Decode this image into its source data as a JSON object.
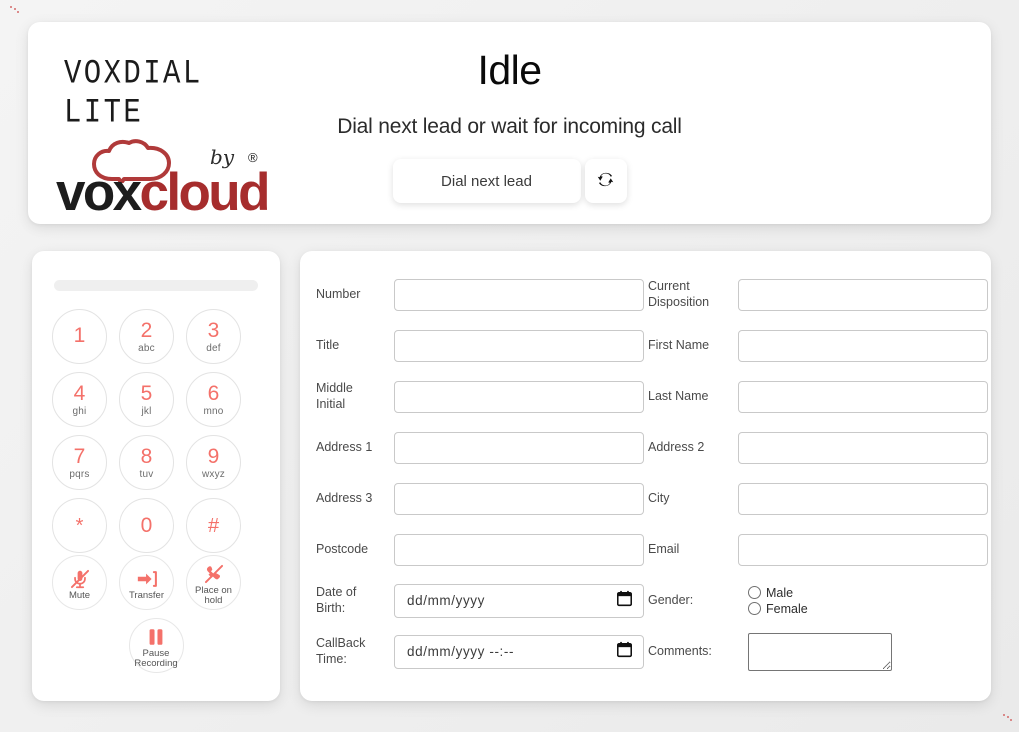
{
  "brand": {
    "product_name": "VOXDIAL LITE",
    "by_text": "by",
    "company_part1": "vox",
    "company_part2": "cloud",
    "registered_mark": "®",
    "brand_red": "#a62d2d",
    "accent_red": "#f4716a"
  },
  "header": {
    "status_title": "Idle",
    "status_subtitle": "Dial next lead or wait for incoming call",
    "dial_button_label": "Dial next lead",
    "refresh_icon": "refresh-icon"
  },
  "dialpad": {
    "keys": [
      {
        "digit": "1",
        "letters": ""
      },
      {
        "digit": "2",
        "letters": "abc"
      },
      {
        "digit": "3",
        "letters": "def"
      },
      {
        "digit": "4",
        "letters": "ghi"
      },
      {
        "digit": "5",
        "letters": "jkl"
      },
      {
        "digit": "6",
        "letters": "mno"
      },
      {
        "digit": "7",
        "letters": "pqrs"
      },
      {
        "digit": "8",
        "letters": "tuv"
      },
      {
        "digit": "9",
        "letters": "wxyz"
      },
      {
        "digit": "*",
        "letters": ""
      },
      {
        "digit": "0",
        "letters": ""
      },
      {
        "digit": "#",
        "letters": ""
      }
    ],
    "actions": [
      {
        "label": "Mute",
        "icon": "microphone-muted-icon"
      },
      {
        "label": "Transfer",
        "icon": "transfer-arrow-icon"
      },
      {
        "label_line1": "Place on",
        "label_line2": "hold",
        "icon": "phone-hold-icon"
      },
      {
        "label_line1": "Pause",
        "label_line2": "Recording",
        "icon": "pause-icon"
      }
    ]
  },
  "form": {
    "rows": [
      {
        "left_label": "Number",
        "left_value": "",
        "right_label_line1": "Current",
        "right_label_line2": "Disposition",
        "right_value": ""
      },
      {
        "left_label": "Title",
        "left_value": "",
        "right_label_line1": "First Name",
        "right_label_line2": "",
        "right_value": ""
      },
      {
        "left_label_line1": "Middle",
        "left_label_line2": "Initial",
        "left_value": "",
        "right_label_line1": "Last Name",
        "right_label_line2": "",
        "right_value": ""
      },
      {
        "left_label": "Address 1",
        "left_value": "",
        "right_label_line1": "Address 2",
        "right_label_line2": "",
        "right_value": ""
      },
      {
        "left_label": "Address 3",
        "left_value": "",
        "right_label_line1": "City",
        "right_label_line2": "",
        "right_value": ""
      },
      {
        "left_label": "Postcode",
        "left_value": "",
        "right_label_line1": "Email",
        "right_label_line2": "",
        "right_value": ""
      }
    ],
    "dob": {
      "label_line1": "Date of",
      "label_line2": "Birth:",
      "placeholder": "dd/mm/yyyy",
      "value": "",
      "calendar_icon": "calendar-icon"
    },
    "gender": {
      "label": "Gender:",
      "options": [
        "Male",
        "Female"
      ],
      "selected": ""
    },
    "callback": {
      "label_line1": "CallBack",
      "label_line2": "Time:",
      "placeholder": "dd/mm/yyyy --:--",
      "value": "",
      "calendar_icon": "calendar-icon"
    },
    "comments": {
      "label": "Comments:",
      "value": "",
      "placeholder": ""
    }
  }
}
